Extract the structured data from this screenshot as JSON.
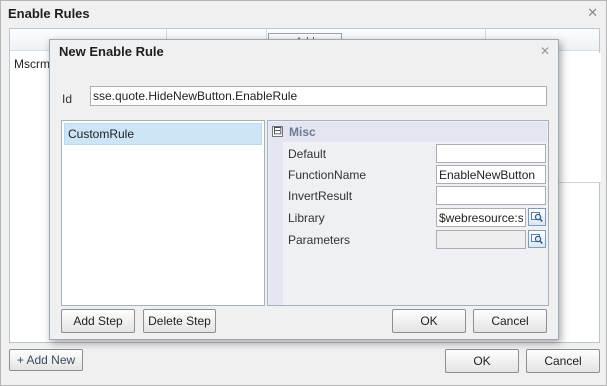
{
  "outer_dialog": {
    "title": "Enable Rules",
    "close_glyph": "✕",
    "grid_header_button": "Add",
    "row_text": "Mscrm.I",
    "add_new_label": "+ Add New",
    "ok_label": "OK",
    "cancel_label": "Cancel"
  },
  "inner_dialog": {
    "title": "New Enable Rule",
    "close_glyph": "✕",
    "id_label": "Id",
    "id_value": "sse.quote.HideNewButton.EnableRule",
    "steps": [
      {
        "label": "CustomRule",
        "selected": true
      }
    ],
    "property_category": {
      "toggle": "⊟",
      "label": "Misc"
    },
    "properties": [
      {
        "label": "Default",
        "value": ""
      },
      {
        "label": "FunctionName",
        "value": "EnableNewButton"
      },
      {
        "label": "InvertResult",
        "value": ""
      },
      {
        "label": "Library",
        "value": "$webresource:sse",
        "lookup_icon": "lookup-icon"
      },
      {
        "label": "Parameters",
        "value": "",
        "lookup_icon": "lookup-icon"
      }
    ],
    "add_step_label": "Add Step",
    "delete_step_label": "Delete Step",
    "ok_label": "OK",
    "cancel_label": "Cancel"
  },
  "colors": {
    "dialog_bg": "#f0f0f0",
    "selected_step": "#cde6f7",
    "category_text": "#6c7b95",
    "category_bg": "#e3e6f0"
  }
}
